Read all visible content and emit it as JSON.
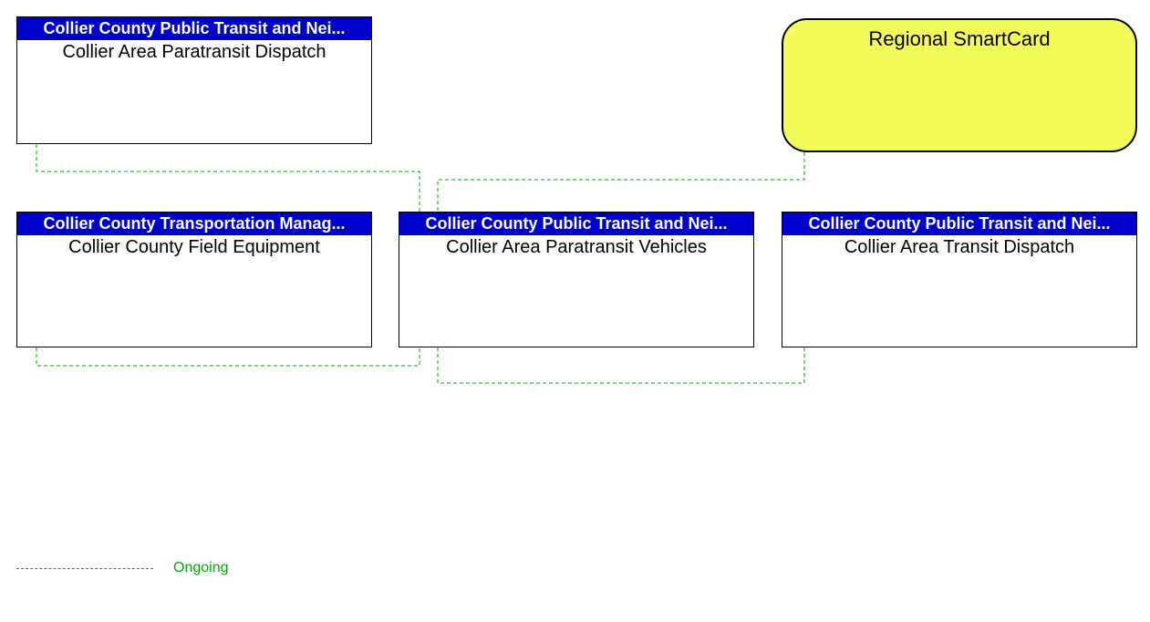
{
  "boxes": {
    "paratransit_dispatch": {
      "header": "Collier County Public Transit and Nei...",
      "body": "Collier Area Paratransit Dispatch"
    },
    "field_equipment": {
      "header": "Collier County Transportation Manag...",
      "body": "Collier County Field Equipment"
    },
    "paratransit_vehicles": {
      "header": "Collier County Public Transit and Nei...",
      "body": "Collier Area Paratransit Vehicles"
    },
    "transit_dispatch": {
      "header": "Collier County Public Transit and Nei...",
      "body": "Collier Area Transit Dispatch"
    }
  },
  "rounded": {
    "smartcard": {
      "label": "Regional SmartCard",
      "bg": "#f3fc5a"
    }
  },
  "legend": {
    "ongoing": "Ongoing"
  },
  "colors": {
    "connector": "#00aa00",
    "header_bg": "#0000cc"
  }
}
